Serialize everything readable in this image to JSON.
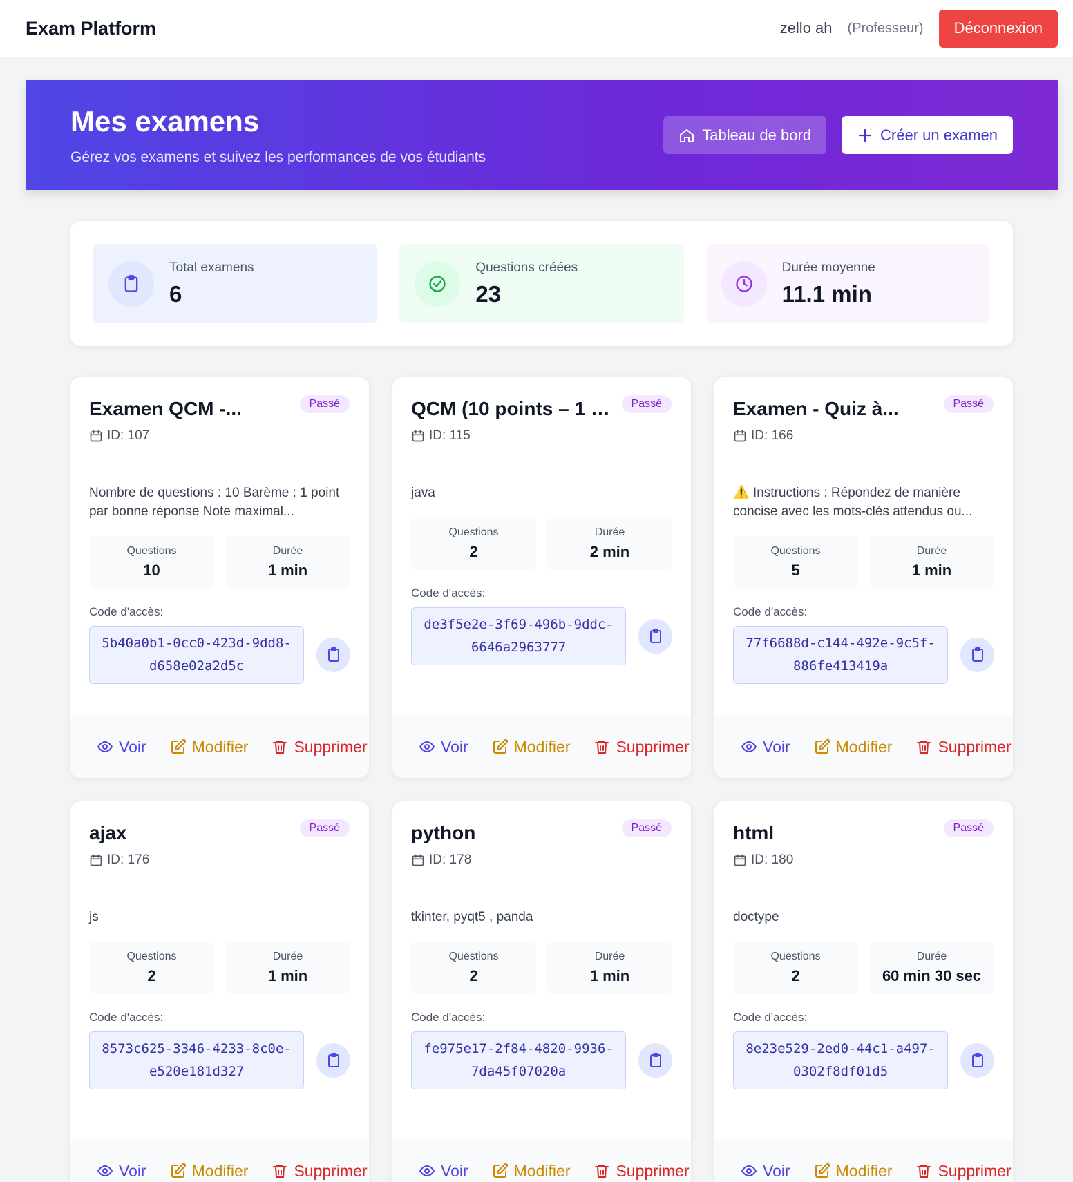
{
  "nav": {
    "brand": "Exam Platform",
    "username": "zello ah",
    "role": "(Professeur)",
    "logout_label": "Déconnexion"
  },
  "hero": {
    "title": "Mes examens",
    "subtitle": "Gérez vos examens et suivez les performances de vos étudiants",
    "dashboard_label": "Tableau de bord",
    "create_label": "Créer un examen"
  },
  "stats": [
    {
      "label": "Total examens",
      "value": "6",
      "icon": "clipboard-icon"
    },
    {
      "label": "Questions créées",
      "value": "23",
      "icon": "check-circle-icon"
    },
    {
      "label": "Durée moyenne",
      "value": "11.1 min",
      "icon": "clock-icon"
    }
  ],
  "labels": {
    "questions": "Questions",
    "duration": "Durée",
    "access_code": "Code d'accès:",
    "view": "Voir",
    "edit": "Modifier",
    "delete": "Supprimer"
  },
  "exams": [
    {
      "title": "Examen QCM -...",
      "status": "Passé",
      "id": "ID: 107",
      "description": "Nombre de questions : 10 Barème : 1 point par bonne réponse Note maximal...",
      "questions": "10",
      "duration": "1 min",
      "code": "5b40a0b1-0cc0-423d-9dd8-d658e02a2d5c"
    },
    {
      "title": "QCM (10 points – 1 p...",
      "status": "Passé",
      "id": "ID: 115",
      "description": "java",
      "questions": "2",
      "duration": "2 min",
      "code": "de3f5e2e-3f69-496b-9ddc-6646a2963777"
    },
    {
      "title": "Examen - Quiz à...",
      "status": "Passé",
      "id": "ID: 166",
      "description": "⚠️ Instructions : Répondez de manière concise avec les mots-clés attendus ou...",
      "questions": "5",
      "duration": "1 min",
      "code": "77f6688d-c144-492e-9c5f-886fe413419a"
    },
    {
      "title": "ajax",
      "status": "Passé",
      "id": "ID: 176",
      "description": "js",
      "questions": "2",
      "duration": "1 min",
      "code": "8573c625-3346-4233-8c0e-e520e181d327"
    },
    {
      "title": "python",
      "status": "Passé",
      "id": "ID: 178",
      "description": "tkinter, pyqt5 , panda",
      "questions": "2",
      "duration": "1 min",
      "code": "fe975e17-2f84-4820-9936-7da45f07020a"
    },
    {
      "title": "html",
      "status": "Passé",
      "id": "ID: 180",
      "description": "doctype",
      "questions": "2",
      "duration": "60 min 30 sec",
      "code": "8e23e529-2ed0-44c1-a497-0302f8df01d5"
    }
  ]
}
